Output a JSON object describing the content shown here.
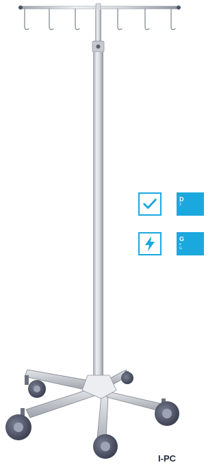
{
  "colors": {
    "accent": "#1ba8de",
    "pole": "#c9ccd2",
    "wheel": "#4d5263"
  },
  "features": [
    {
      "icon": "checkmark-icon",
      "title": "D",
      "subtitle": "3"
    },
    {
      "icon": "lightning-icon",
      "title": "G",
      "subtitle": "e\nG"
    }
  ],
  "product": {
    "label": "I-PC"
  }
}
